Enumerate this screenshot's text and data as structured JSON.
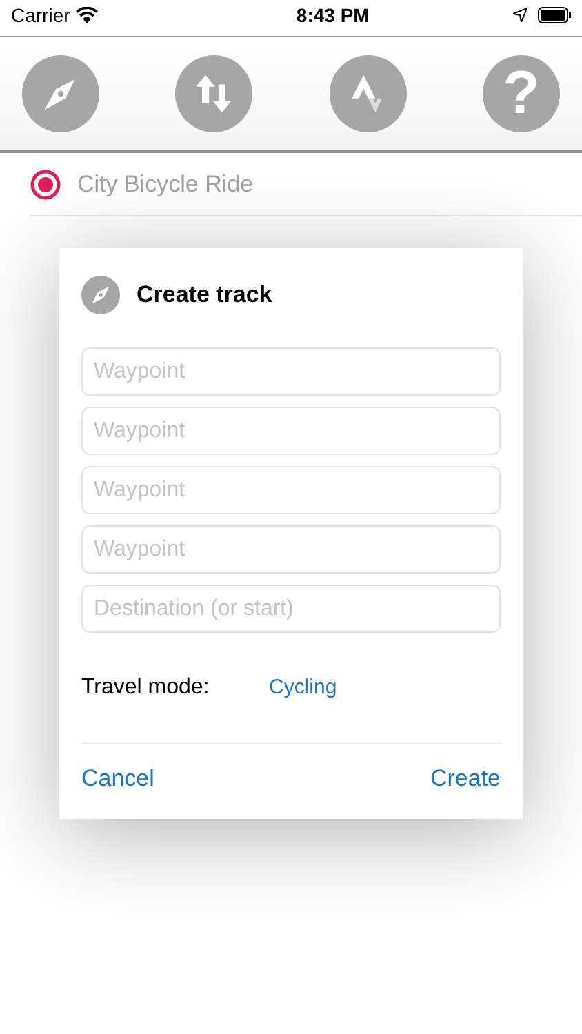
{
  "status_bar": {
    "carrier": "Carrier",
    "time": "8:43 PM"
  },
  "toolbar": {
    "help_label": "?"
  },
  "tracks": [
    {
      "label": "City Bicycle Ride",
      "selected": true
    }
  ],
  "dialog": {
    "title": "Create track",
    "fields": [
      {
        "placeholder": "Waypoint"
      },
      {
        "placeholder": "Waypoint"
      },
      {
        "placeholder": "Waypoint"
      },
      {
        "placeholder": "Waypoint"
      },
      {
        "placeholder": "Destination (or start)"
      }
    ],
    "travel_mode": {
      "label": "Travel mode:",
      "value": "Cycling"
    },
    "buttons": [
      {
        "label": "Cancel"
      },
      {
        "label": "Create"
      }
    ]
  }
}
